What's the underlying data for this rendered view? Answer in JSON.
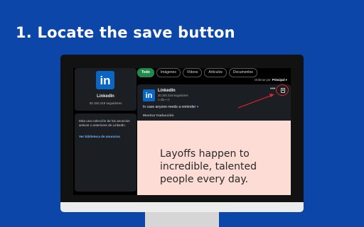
{
  "heading": "1. Locate the save button",
  "profile": {
    "logo": "in",
    "name": "LinkedIn",
    "followers": "30.150.318 seguidores"
  },
  "ads": {
    "text": "Mira una colección de los anuncios activos o anteriores de LinkedIn.",
    "link": "Ver biblioteca de anuncios"
  },
  "tabs": [
    {
      "label": "Todo",
      "active": true
    },
    {
      "label": "Imágenes"
    },
    {
      "label": "Vídeos"
    },
    {
      "label": "Artículos"
    },
    {
      "label": "Documentos"
    }
  ],
  "sort": {
    "prefix": "Ordenar por:",
    "value": "Principal ▾"
  },
  "post": {
    "logo": "in",
    "author": "LinkedIn",
    "followers": "30.150.318 seguidores",
    "time": "1 día • ◷",
    "text": "In case anyone needs a reminder",
    "heart": "♥",
    "translate": "Mostrar traducción",
    "more": "•••",
    "image_text": "Layoffs happen to incredible, talented people every day."
  },
  "icons": {
    "save": "bookmark-icon",
    "more": "more-options-icon",
    "highlight": "red-circle-annotation",
    "arrow": "red-arrow-annotation"
  },
  "colors": {
    "background": "#0b46a8",
    "linkedin_blue": "#0a66c2",
    "active_tab": "#1f8a4c",
    "annotation_red": "#e0252b",
    "image_bg": "#fcdcd4"
  }
}
